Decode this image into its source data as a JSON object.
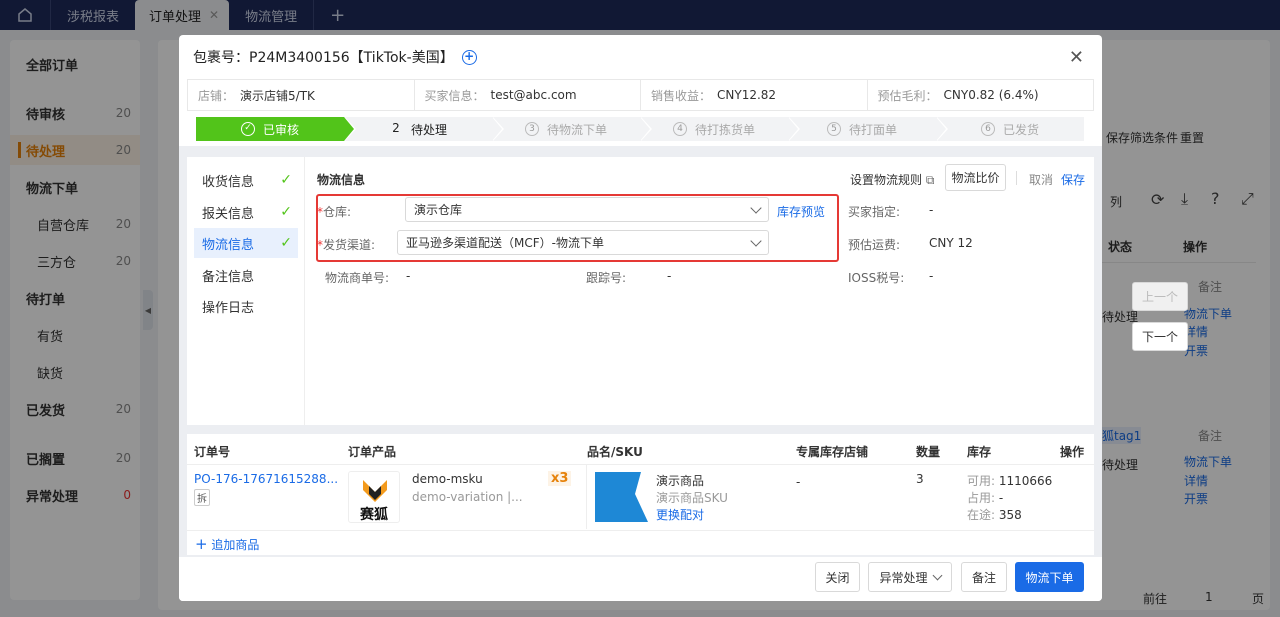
{
  "topbar": {
    "tabs": [
      {
        "label": "涉税报表",
        "active": false,
        "closable": false
      },
      {
        "label": "订单处理",
        "active": true,
        "closable": true
      },
      {
        "label": "物流管理",
        "active": false,
        "closable": false
      }
    ],
    "close_glyph": "✕",
    "add_tab_glyph": "+"
  },
  "sidebar": {
    "items": [
      {
        "label": "全部订单",
        "count": "",
        "level": 1
      },
      {
        "label": "待审核",
        "count": "20",
        "level": 1
      },
      {
        "label": "待处理",
        "count": "20",
        "level": 1,
        "active": true
      },
      {
        "label": "物流下单",
        "count": "",
        "level": 1
      },
      {
        "label": "自营仓库",
        "count": "20",
        "level": 2
      },
      {
        "label": "三方仓",
        "count": "20",
        "level": 2
      },
      {
        "label": "待打单",
        "count": "",
        "level": 1
      },
      {
        "label": "有货",
        "count": "",
        "level": 2
      },
      {
        "label": "缺货",
        "count": "",
        "level": 2
      },
      {
        "label": "已发货",
        "count": "20",
        "level": 1
      },
      {
        "label": "已搁置",
        "count": "20",
        "level": 1
      },
      {
        "label": "异常处理",
        "count": "0",
        "level": 1
      }
    ]
  },
  "background": {
    "save_filter": "保存筛选条件",
    "reset": "重置",
    "columns": "列",
    "status_header": "状态",
    "op_header": "操作",
    "row1": {
      "status": "待处理",
      "remark": "备注",
      "actions": [
        "物流下单",
        "详情",
        "开票"
      ]
    },
    "row2": {
      "tag": "狐tag1",
      "status": "待处理",
      "remark": "备注",
      "actions": [
        "物流下单",
        "详情",
        "开票"
      ]
    },
    "prev_button": "上一个",
    "next_button": "下一个",
    "goto_label": "前往",
    "goto_page": "1",
    "page_unit": "页"
  },
  "modal": {
    "title_prefix": "包裹号：",
    "package_no": "P24M3400156【TikTok-美国】",
    "info": [
      {
        "label": "店铺：",
        "value": "演示店铺5/TK"
      },
      {
        "label": "买家信息：",
        "value": "test@abc.com"
      },
      {
        "label": "销售收益：",
        "value": "CNY12.82"
      },
      {
        "label": "预估毛利：",
        "value": "CNY0.82 (6.4%)"
      }
    ],
    "steps": [
      {
        "num": "",
        "label": "已审核",
        "state": "done"
      },
      {
        "num": "2",
        "label": "待处理",
        "state": "current"
      },
      {
        "num": "3",
        "label": "待物流下单",
        "state": "todo"
      },
      {
        "num": "4",
        "label": "待打拣货单",
        "state": "todo"
      },
      {
        "num": "5",
        "label": "待打面单",
        "state": "todo"
      },
      {
        "num": "6",
        "label": "已发货",
        "state": "todo"
      }
    ],
    "nav": [
      {
        "label": "收货信息",
        "done": true
      },
      {
        "label": "报关信息",
        "done": true
      },
      {
        "label": "物流信息",
        "done": true,
        "active": true
      },
      {
        "label": "备注信息",
        "done": false
      },
      {
        "label": "操作日志",
        "done": false
      }
    ],
    "logistics": {
      "section_title": "物流信息",
      "set_rule": "设置物流规则",
      "compare": "物流比价",
      "cancel": "取消",
      "save": "保存",
      "warehouse_label": "仓库:",
      "warehouse_value": "演示仓库",
      "stock_preview": "库存预览",
      "channel_label": "发货渠道:",
      "channel_value": "亚马逊多渠道配送（MCF）-物流下单",
      "buyer_designated_label": "买家指定:",
      "buyer_designated_value": "-",
      "est_freight_label": "预估运费:",
      "est_freight_value": "CNY 12",
      "logistics_no_label": "物流商单号:",
      "logistics_no_value": "-",
      "tracking_label": "跟踪号:",
      "tracking_value": "-",
      "ioss_label": "IOSS税号:",
      "ioss_value": "-"
    },
    "table": {
      "headers": [
        "订单号",
        "订单产品",
        "品名/SKU",
        "专属库存店铺",
        "数量",
        "库存",
        "操作"
      ],
      "row": {
        "order_no": "PO-176-17671615288...",
        "split_tag": "拆",
        "logo_text": "赛狐",
        "msku": "demo-msku",
        "variation": "demo-variation |...",
        "qty_badge": "x3",
        "product_name": "演示商品",
        "product_sku": "演示商品SKU",
        "rematch": "更换配对",
        "shop": "-",
        "qty": "3",
        "stock_available_label": "可用:",
        "stock_available": "1110666",
        "stock_occupied_label": "占用:",
        "stock_occupied": "-",
        "stock_transit_label": "在途:",
        "stock_transit": "358"
      },
      "add_product": "追加商品"
    },
    "footer": {
      "close": "关闭",
      "exception": "异常处理",
      "remark": "备注",
      "submit": "物流下单"
    }
  },
  "colors": {
    "accent": "#1a6be6",
    "success": "#52c41a",
    "warning": "#e6820a",
    "highlight_box": "#e53935",
    "navbar": "#1e2a5a"
  }
}
